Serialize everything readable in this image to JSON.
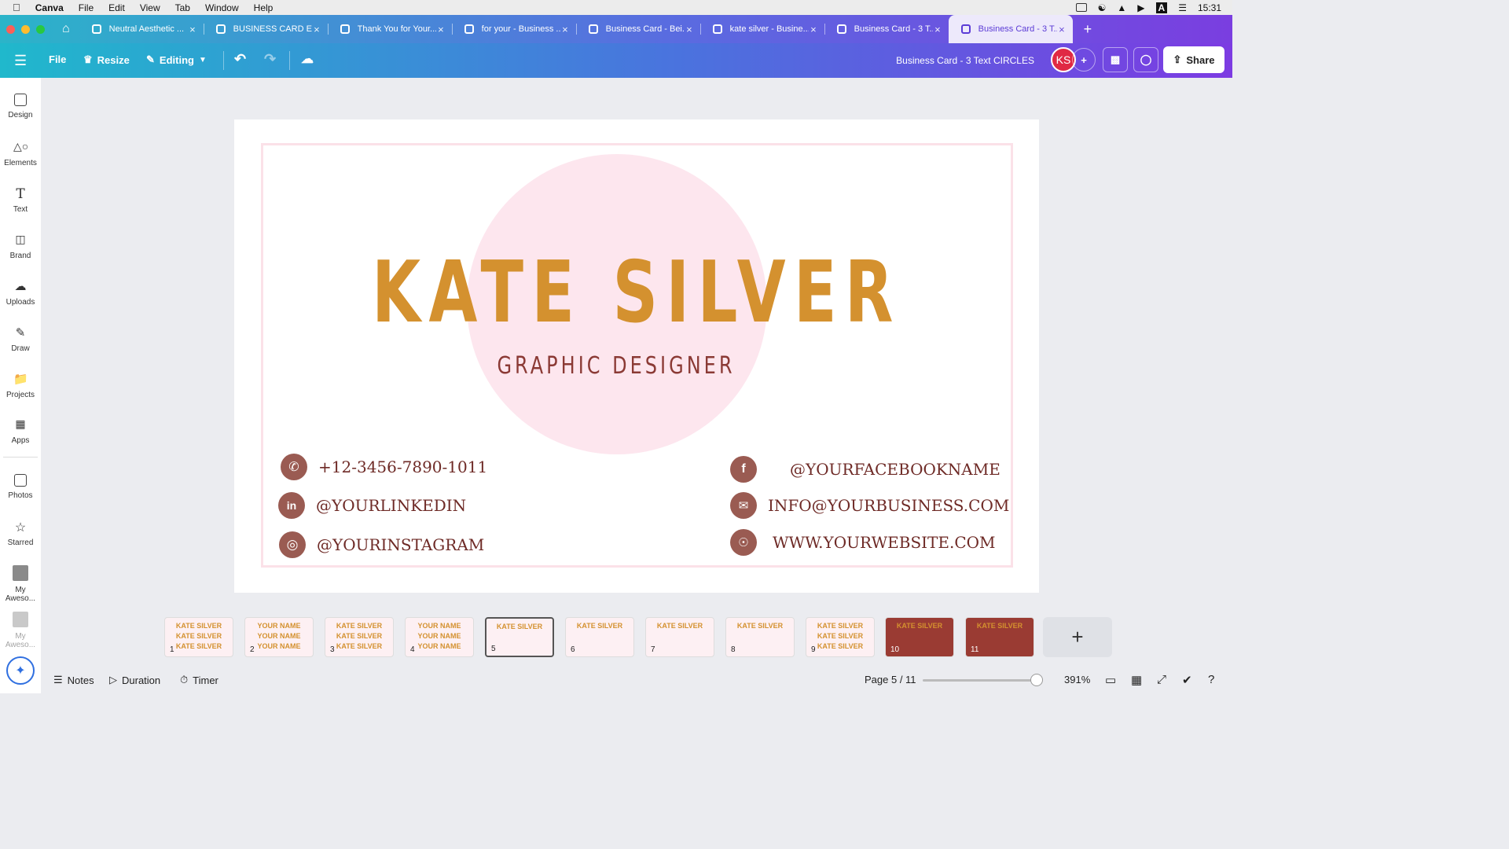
{
  "macmenu": {
    "apple": "",
    "items": [
      "Canva",
      "File",
      "Edit",
      "View",
      "Tab",
      "Window",
      "Help"
    ],
    "clock": "15:31"
  },
  "tabs": [
    {
      "label": "Neutral Aesthetic ...",
      "active": false
    },
    {
      "label": "BUSINESS CARD E...",
      "active": false
    },
    {
      "label": "Thank You for Your...",
      "active": false
    },
    {
      "label": "for your - Business ...",
      "active": false
    },
    {
      "label": "Business Card - Bei...",
      "active": false
    },
    {
      "label": "kate silver - Busine...",
      "active": false
    },
    {
      "label": "Business Card - 3 T...",
      "active": false
    },
    {
      "label": "Business Card - 3 T...",
      "active": true
    }
  ],
  "toolbar": {
    "file": "File",
    "resize": "Resize",
    "editing": "Editing",
    "doc_title": "Business Card - 3 Text CIRCLES",
    "avatar": "KS",
    "share": "Share"
  },
  "sidebar": [
    "Design",
    "Elements",
    "Text",
    "Brand",
    "Uploads",
    "Draw",
    "Projects",
    "Apps",
    "Photos",
    "Starred",
    "My Aweso...",
    "My Aweso..."
  ],
  "card": {
    "name": "KATE SILVER",
    "title": "GRAPHIC DESIGNER",
    "phone": "+12-3456-7890-1011",
    "linkedin": "@YOURLINKEDIN",
    "instagram": "@YOURINSTAGRAM",
    "facebook": "@YOURFACEBOOKNAME",
    "email": "INFO@YOURBUSINESS.COM",
    "website": "WWW.YOURWEBSITE.COM",
    "colors": {
      "name": "#d4912f",
      "accent": "#8b3a35",
      "circle": "#fde6ee",
      "icon": "#9a5b52"
    }
  },
  "pages": [
    {
      "n": "1",
      "lines": [
        "KATE SILVER",
        "KATE SILVER",
        "KATE SILVER"
      ],
      "dark": false
    },
    {
      "n": "2",
      "lines": [
        "YOUR NAME",
        "YOUR NAME",
        "YOUR NAME"
      ],
      "dark": false
    },
    {
      "n": "3",
      "lines": [
        "KATE SILVER",
        "KATE SILVER",
        "KATE SILVER"
      ],
      "dark": false
    },
    {
      "n": "4",
      "lines": [
        "YOUR NAME",
        "YOUR NAME",
        "YOUR NAME"
      ],
      "dark": false
    },
    {
      "n": "5",
      "lines": [
        "KATE SILVER"
      ],
      "dark": false
    },
    {
      "n": "6",
      "lines": [
        "KATE SILVER"
      ],
      "dark": false
    },
    {
      "n": "7",
      "lines": [
        "KATE SILVER"
      ],
      "dark": false
    },
    {
      "n": "8",
      "lines": [
        "KATE SILVER"
      ],
      "dark": false
    },
    {
      "n": "9",
      "lines": [
        "KATE SILVER",
        "KATE SILVER",
        "KATE SILVER"
      ],
      "dark": false
    },
    {
      "n": "10",
      "lines": [
        "KATE SILVER"
      ],
      "dark": true
    },
    {
      "n": "11",
      "lines": [
        "KATE SILVER"
      ],
      "dark": true
    }
  ],
  "bottom": {
    "notes": "Notes",
    "duration": "Duration",
    "timer": "Timer",
    "page_indicator": "Page 5 / 11",
    "zoom": "391%"
  }
}
